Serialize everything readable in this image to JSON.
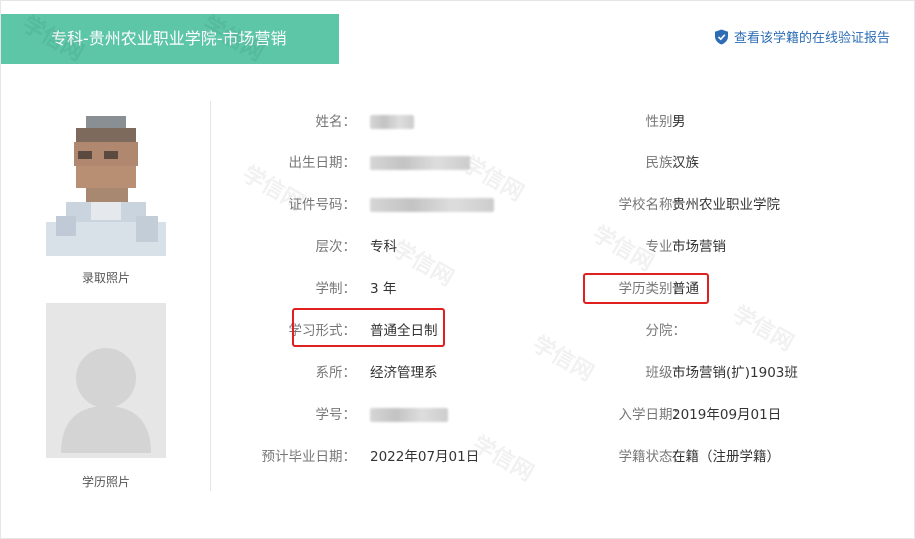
{
  "header": {
    "title": "专科-贵州农业职业学院-市场营销",
    "verify_link": "查看该学籍的在线验证报告"
  },
  "photos": {
    "admission_caption": "录取照片",
    "education_caption": "学历照片"
  },
  "fields_left": [
    {
      "label": "姓名：",
      "value": ""
    },
    {
      "label": "出生日期：",
      "value": ""
    },
    {
      "label": "证件号码：",
      "value": ""
    },
    {
      "label": "层次：",
      "value": "专科"
    },
    {
      "label": "学制：",
      "value": "3 年"
    },
    {
      "label": "学习形式：",
      "value": "普通全日制"
    },
    {
      "label": "系所：",
      "value": "经济管理系"
    },
    {
      "label": "学号：",
      "value": ""
    },
    {
      "label": "预计毕业日期：",
      "value": "2022年07月01日"
    }
  ],
  "fields_right": [
    {
      "label": "性别：",
      "value": "男"
    },
    {
      "label": "民族：",
      "value": "汉族"
    },
    {
      "label": "学校名称：",
      "value": "贵州农业职业学院"
    },
    {
      "label": "专业：",
      "value": "市场营销"
    },
    {
      "label": "学历类别：",
      "value": "普通"
    },
    {
      "label": "分院：",
      "value": ""
    },
    {
      "label": "班级：",
      "value": "市场营销(扩)1903班"
    },
    {
      "label": "入学日期：",
      "value": "2019年09月01日"
    },
    {
      "label": "学籍状态：",
      "value": "在籍（注册学籍）"
    }
  ],
  "watermark_text": "学信网",
  "colors": {
    "header_bg": "#5cc6a7",
    "link": "#2d6db5",
    "highlight": "#e02020"
  }
}
